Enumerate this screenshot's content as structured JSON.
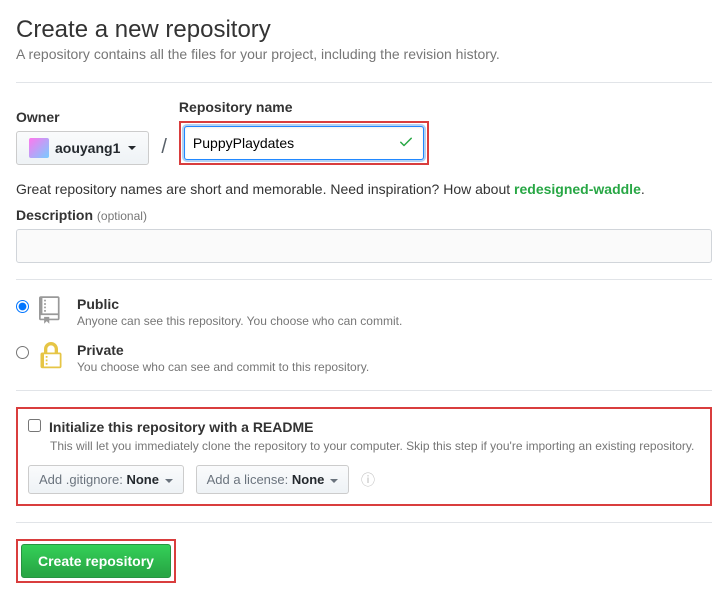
{
  "header": {
    "title": "Create a new repository",
    "subtitle": "A repository contains all the files for your project, including the revision history."
  },
  "owner": {
    "label": "Owner",
    "username": "aouyang1"
  },
  "repo": {
    "label": "Repository name",
    "value": "PuppyPlaydates"
  },
  "hint": {
    "prefix": "Great repository names are short and memorable. Need inspiration? How about ",
    "suggestion": "redesigned-waddle",
    "suffix": "."
  },
  "description": {
    "label": "Description",
    "optional": "(optional)",
    "value": ""
  },
  "visibility": {
    "public": {
      "label": "Public",
      "desc": "Anyone can see this repository. You choose who can commit."
    },
    "private": {
      "label": "Private",
      "desc": "You choose who can see and commit to this repository."
    }
  },
  "readme": {
    "label": "Initialize this repository with a README",
    "desc": "This will let you immediately clone the repository to your computer. Skip this step if you're importing an existing repository."
  },
  "gitignore": {
    "prefix": "Add .gitignore: ",
    "value": "None"
  },
  "license": {
    "prefix": "Add a license: ",
    "value": "None"
  },
  "submit": "Create repository"
}
